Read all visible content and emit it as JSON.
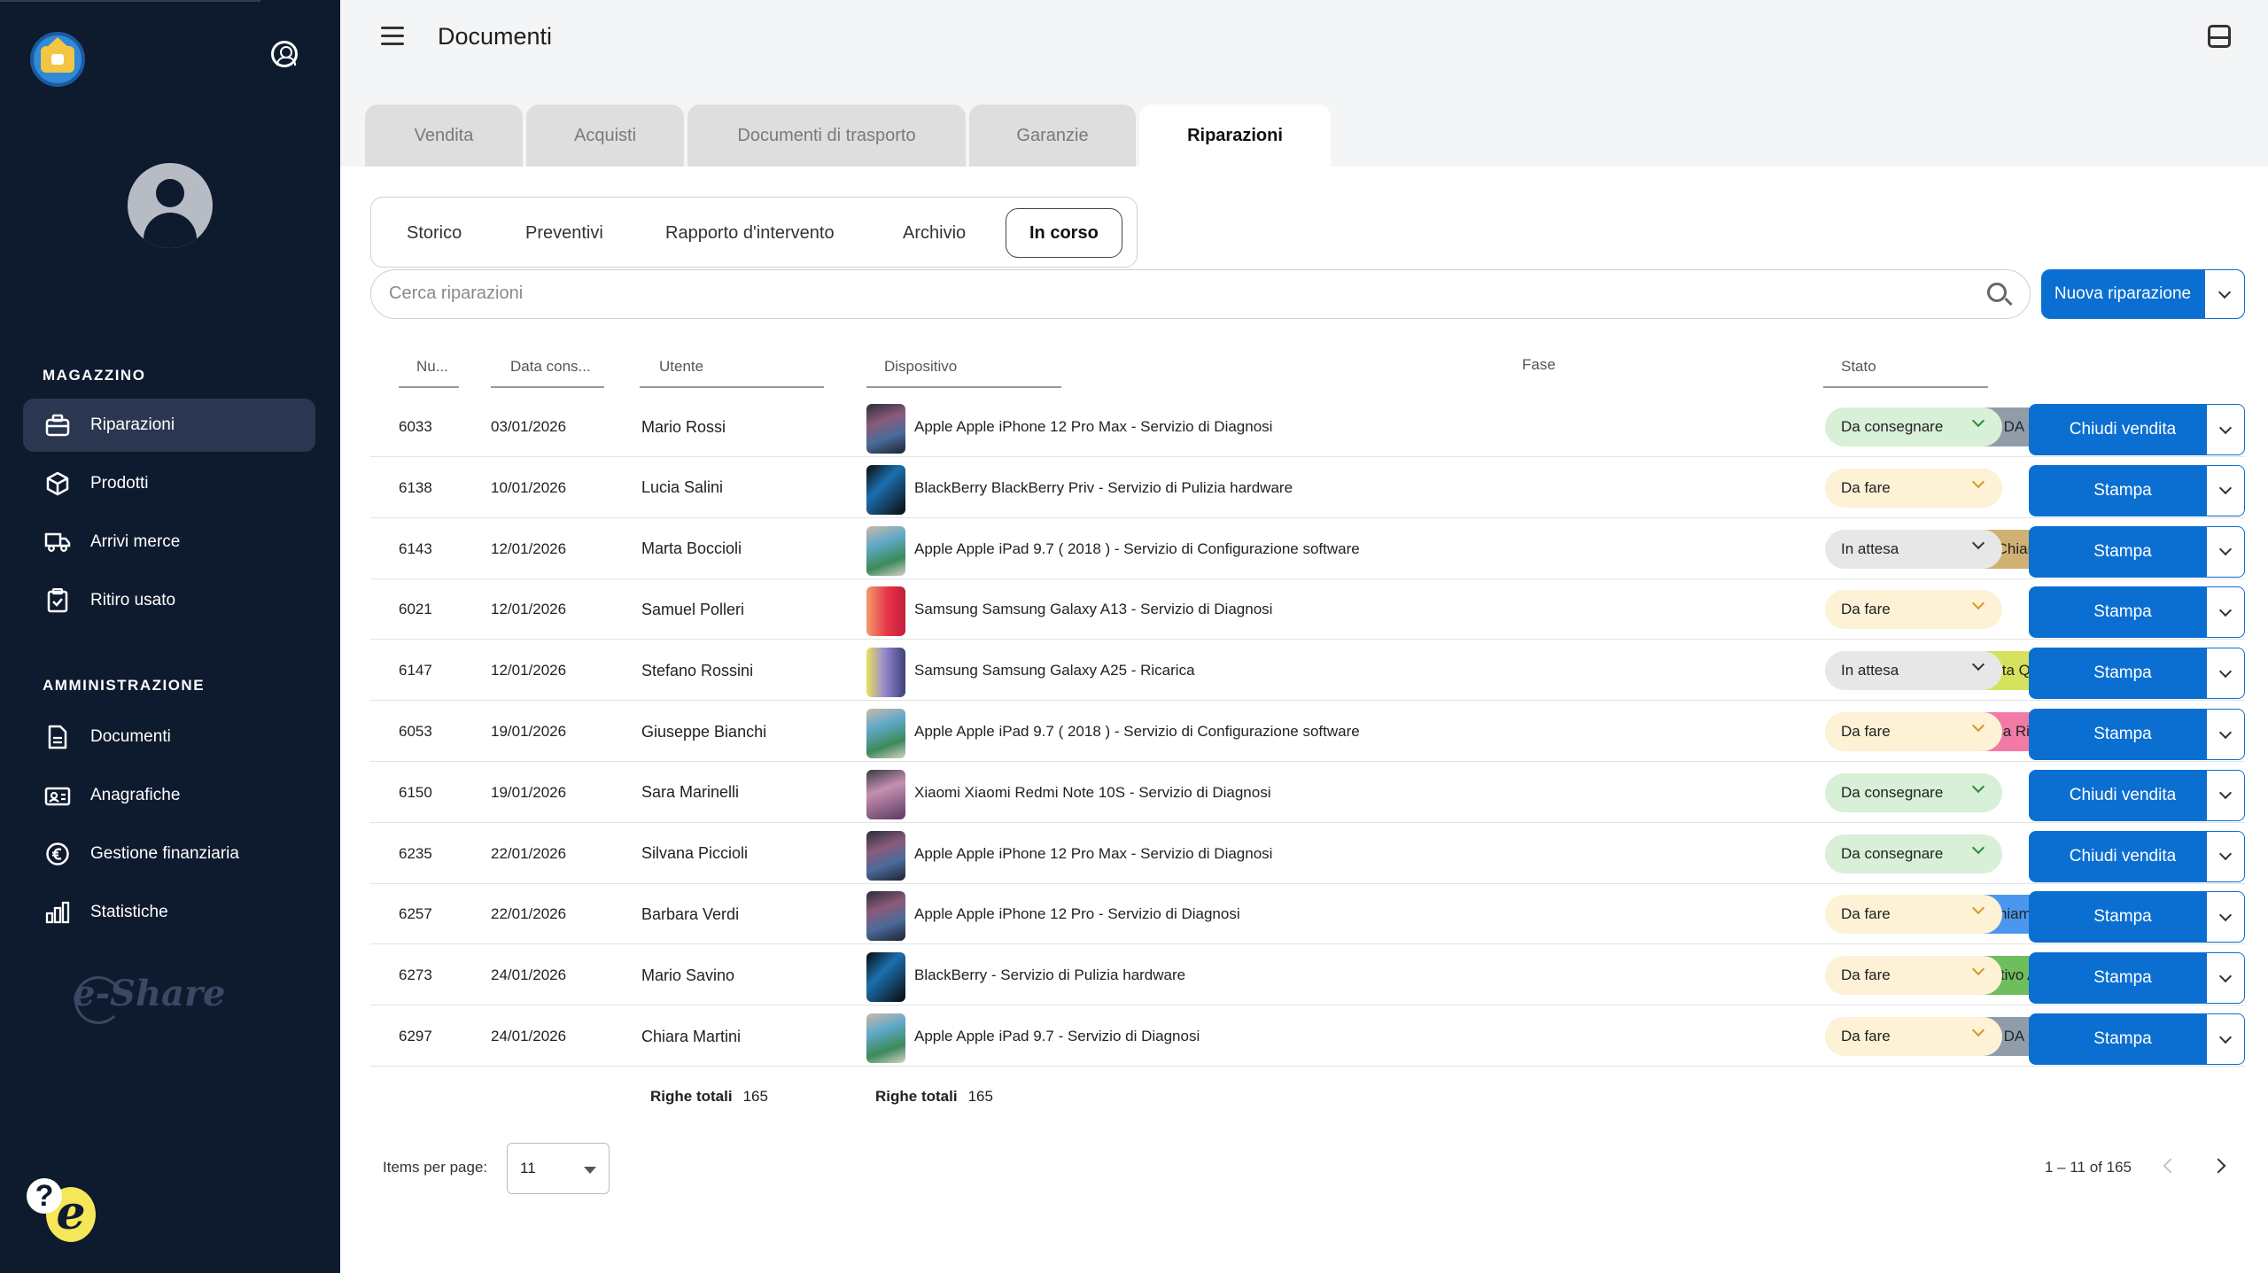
{
  "header": {
    "title": "Documenti"
  },
  "tabs": [
    "Vendita",
    "Acquisti",
    "Documenti di trasporto",
    "Garanzie",
    "Riparazioni"
  ],
  "subtabs": [
    "Storico",
    "Preventivi",
    "Rapporto d'intervento",
    "Archivio",
    "In corso"
  ],
  "sidebar": {
    "section1": "MAGAZZINO",
    "items1": [
      "Riparazioni",
      "Prodotti",
      "Arrivi merce",
      "Ritiro usato"
    ],
    "section2": "AMMINISTRAZIONE",
    "items2": [
      "Documenti",
      "Anagrafiche",
      "Gestione finanziaria",
      "Statistiche"
    ],
    "brand": "e-Share"
  },
  "search": {
    "placeholder": "Cerca riparazioni"
  },
  "new_button": "Nuova riparazione",
  "columns": [
    "Nu...",
    "Data cons...",
    "Utente",
    "Dispositivo",
    "Fase",
    "Stato"
  ],
  "colors": {
    "sidebar_bg": "#0e1a2e",
    "primary": "#0b6fd1"
  },
  "rows": [
    {
      "num": "6033",
      "date": "03/01/2026",
      "user": "Mario Rossi",
      "device": "Apple Apple iPhone 12 Pro Max - Servizio di Diagnosi",
      "thumb": "iphone",
      "fase": "Cliente DA CHIAMARE",
      "fase_color": "#909da9",
      "stato": "Da consegnare",
      "stato_color": "#d7f0d7",
      "action": "Chiudi vendita"
    },
    {
      "num": "6138",
      "date": "10/01/2026",
      "user": "Lucia Salini",
      "device": "BlackBerry BlackBerry Priv - Servizio di Pulizia hardware",
      "thumb": "blackberry",
      "fase": "",
      "fase_color": "",
      "stato": "Da fare",
      "stato_color": "#fdf1d6",
      "action": "Stampa"
    },
    {
      "num": "6143",
      "date": "12/01/2026",
      "user": "Marta Boccioli",
      "device": "Apple Apple iPad 9.7 ( 2018 ) - Servizio di Configurazione software",
      "thumb": "ipad",
      "fase": "Cliente Chiamato senza Risposta",
      "fase_color": "#d0b172",
      "stato": "In attesa",
      "stato_color": "#e7e7e7",
      "action": "Stampa"
    },
    {
      "num": "6021",
      "date": "12/01/2026",
      "user": "Samuel Polleri",
      "device": "Samsung Samsung Galaxy A13 - Servizio di Diagnosi",
      "thumb": "galaxy-a13",
      "fase": "",
      "fase_color": "",
      "stato": "Da fare",
      "stato_color": "#fdf1d6",
      "action": "Stampa"
    },
    {
      "num": "6147",
      "date": "12/01/2026",
      "user": "Stefano Rossini",
      "device": "Samsung Samsung Galaxy A25 - Ricarica",
      "thumb": "galaxy-a25",
      "fase": "Richiesta Quotazione",
      "fase_color": "#d6e15e",
      "stato": "In attesa",
      "stato_color": "#e7e7e7",
      "action": "Stampa"
    },
    {
      "num": "6053",
      "date": "19/01/2026",
      "user": "Giuseppe Bianchi",
      "device": "Apple Apple iPad 9.7 ( 2018 ) - Servizio di Configurazione software",
      "thumb": "ipad",
      "fase": "In Attesa Risposta Cliente",
      "fase_color": "#f17aa7",
      "stato": "Da fare",
      "stato_color": "#fdf1d6",
      "action": "Stampa"
    },
    {
      "num": "6150",
      "date": "19/01/2026",
      "user": "Sara Marinelli",
      "device": "Xiaomi Xiaomi Redmi Note 10S - Servizio di Diagnosi",
      "thumb": "xiaomi",
      "fase": "",
      "fase_color": "",
      "stato": "Da consegnare",
      "stato_color": "#d7f0d7",
      "action": "Chiudi vendita"
    },
    {
      "num": "6235",
      "date": "22/01/2026",
      "user": "Silvana Piccioli",
      "device": "Apple Apple iPhone 12 Pro Max - Servizio di Diagnosi",
      "thumb": "iphone",
      "fase": "",
      "fase_color": "",
      "stato": "Da consegnare",
      "stato_color": "#d7f0d7",
      "action": "Chiudi vendita"
    },
    {
      "num": "6257",
      "date": "22/01/2026",
      "user": "Barbara Verdi",
      "device": "Apple Apple iPhone 12 Pro - Servizio di Diagnosi",
      "thumb": "iphone",
      "fase": "KO - Chiamato senza risposta",
      "fase_color": "#4b97ef",
      "stato": "Da fare",
      "stato_color": "#fdf1d6",
      "action": "Stampa"
    },
    {
      "num": "6273",
      "date": "24/01/2026",
      "user": "Mario Savino",
      "device": "BlackBerry - Servizio di Pulizia hardware",
      "thumb": "blackberry",
      "fase": "Preventivo Accettato",
      "fase_color": "#6fbe5e",
      "stato": "Da fare",
      "stato_color": "#fdf1d6",
      "action": "Stampa"
    },
    {
      "num": "6297",
      "date": "24/01/2026",
      "user": "Chiara Martini",
      "device": "Apple Apple iPad 9.7 - Servizio di Diagnosi",
      "thumb": "ipad",
      "fase": "Cliente DA CHIAMARE",
      "fase_color": "#909da9",
      "stato": "Da fare",
      "stato_color": "#fdf1d6",
      "action": "Stampa"
    }
  ],
  "totals": {
    "label": "Righe totali",
    "value": "165"
  },
  "pagination": {
    "items_label": "Items per page:",
    "items_value": "11",
    "range": "1 – 11 of 165"
  }
}
